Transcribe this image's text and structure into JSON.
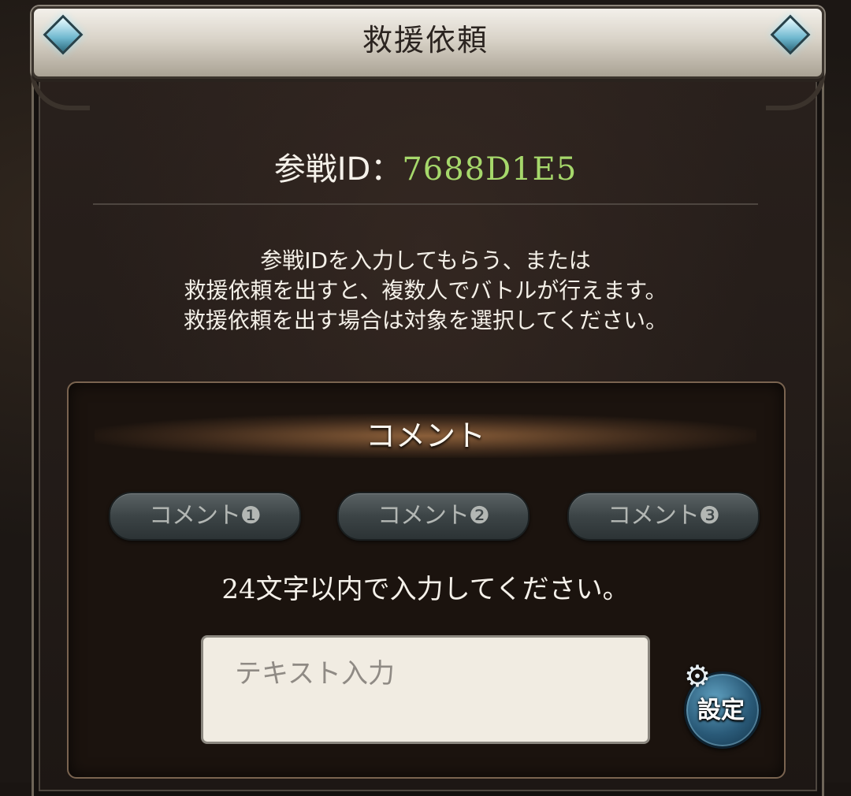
{
  "dialog": {
    "title": "救援依頼",
    "battle_id_label": "参戦ID：",
    "battle_id_value": "7688D1E5",
    "description_lines": [
      "参戦IDを入力してもらう、または",
      "救援依頼を出すと、複数人でバトルが行えます。",
      "救援依頼を出す場合は対象を選択してください。"
    ]
  },
  "comment_panel": {
    "title": "コメント",
    "presets": [
      {
        "label": "コメント❶"
      },
      {
        "label": "コメント❷"
      },
      {
        "label": "コメント❸"
      }
    ],
    "instruction_number": "24",
    "instruction_text": "文字以内で入力してください。",
    "input_placeholder": "テキスト入力",
    "input_value": "",
    "settings_label": "設定",
    "settings_icon": "gear-icon"
  },
  "colors": {
    "battle_id": "#a6d86b",
    "banner": "#e6e1d8",
    "panel_border": "#7a6450"
  }
}
